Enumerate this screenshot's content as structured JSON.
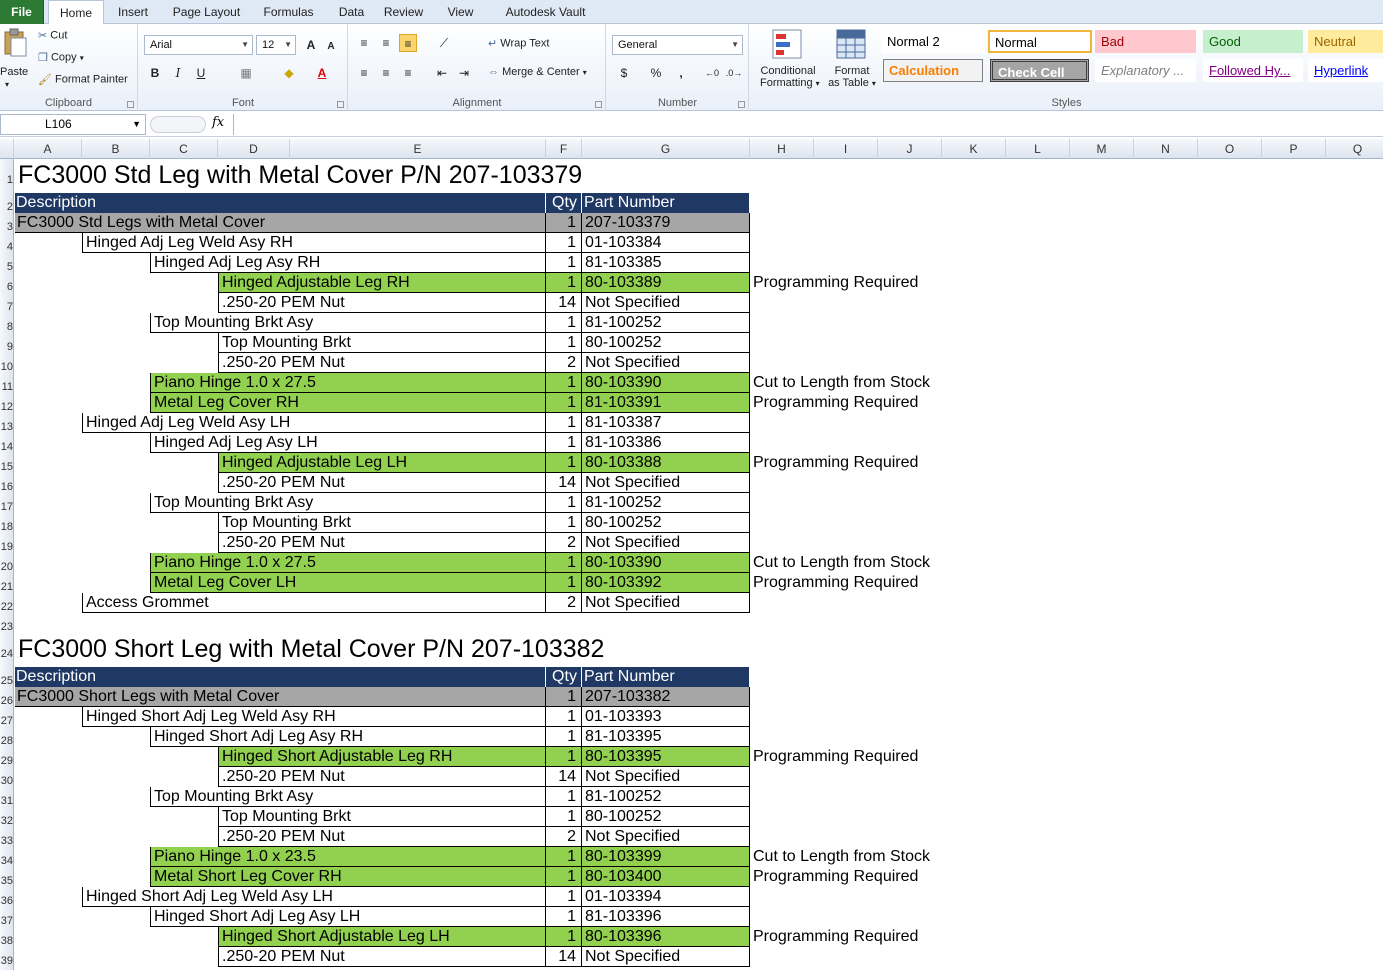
{
  "tabs": [
    {
      "label": "File",
      "kind": "file"
    },
    {
      "label": "Home",
      "kind": "active"
    },
    {
      "label": "Insert"
    },
    {
      "label": "Page Layout"
    },
    {
      "label": "Formulas"
    },
    {
      "label": "Data"
    },
    {
      "label": "Review"
    },
    {
      "label": "View"
    },
    {
      "label": "Autodesk Vault"
    }
  ],
  "ribbon": {
    "clipboard": {
      "paste": "Paste",
      "cut": "Cut",
      "copy": "Copy",
      "format_painter": "Format Painter",
      "group": "Clipboard"
    },
    "font": {
      "name": "Arial",
      "size": "12",
      "group": "Font",
      "bold": "B",
      "italic": "I",
      "underline": "U",
      "grow": "A",
      "shrink": "A"
    },
    "alignment": {
      "wrap": "Wrap Text",
      "merge": "Merge & Center",
      "group": "Alignment"
    },
    "number": {
      "format": "General",
      "currency": "$",
      "percent": "%",
      "comma": ",",
      "group": "Number"
    },
    "cond_format": {
      "line1": "Conditional",
      "line2": "Formatting"
    },
    "format_table": {
      "line1": "Format",
      "line2": "as Table"
    },
    "styles": {
      "group": "Styles",
      "items": [
        {
          "label": "Normal 2",
          "bg": "#ffffff",
          "fg": "#000000"
        },
        {
          "label": "Normal",
          "bg": "#ffffff",
          "fg": "#000000",
          "selected": true
        },
        {
          "label": "Bad",
          "bg": "#ffc7ce",
          "fg": "#9c0006"
        },
        {
          "label": "Good",
          "bg": "#c6efce",
          "fg": "#006100"
        },
        {
          "label": "Neutral",
          "bg": "#ffeb9c",
          "fg": "#9c6500"
        },
        {
          "label": "Calculation",
          "bg": "#f2f2f2",
          "fg": "#fa7d00"
        },
        {
          "label": "Check Cell",
          "bg": "#a5a5a5",
          "fg": "#ffffff"
        },
        {
          "label": "Explanatory ...",
          "bg": "#ffffff",
          "fg": "#7f7f7f"
        },
        {
          "label": "Followed Hy...",
          "bg": "#ffffff",
          "fg": "#800080"
        },
        {
          "label": "Hyperlink",
          "bg": "#ffffff",
          "fg": "#0000ff"
        }
      ]
    }
  },
  "formula_bar": {
    "name_box": "L106",
    "fx": "fx",
    "value": ""
  },
  "columns": [
    "A",
    "B",
    "C",
    "D",
    "E",
    "F",
    "G",
    "H",
    "I",
    "J",
    "K",
    "L",
    "M",
    "N",
    "O",
    "P",
    "Q"
  ],
  "rows": [
    "1",
    "2",
    "3",
    "4",
    "5",
    "6",
    "7",
    "8",
    "9",
    "10",
    "11",
    "12",
    "13",
    "14",
    "15",
    "16",
    "17",
    "18",
    "19",
    "20",
    "21",
    "22",
    "23",
    "24",
    "25",
    "26",
    "27",
    "28",
    "29",
    "30",
    "31",
    "32",
    "33",
    "34",
    "35",
    "36",
    "37",
    "38",
    "39"
  ],
  "sheet": {
    "section1": {
      "title": "FC3000 Std Leg with Metal Cover P/N 207-103379",
      "headers": {
        "desc": "Description",
        "qty": "Qty",
        "pn": "Part Number"
      },
      "items": [
        {
          "level": 0,
          "desc": "FC3000 Std Legs with Metal Cover",
          "qty": "1",
          "pn": "207-103379",
          "style": "gray",
          "note": ""
        },
        {
          "level": 1,
          "desc": "Hinged Adj Leg Weld Asy RH",
          "qty": "1",
          "pn": "01-103384",
          "style": "",
          "note": ""
        },
        {
          "level": 2,
          "desc": "Hinged Adj Leg Asy RH",
          "qty": "1",
          "pn": "81-103385",
          "style": "",
          "note": ""
        },
        {
          "level": 3,
          "desc": "Hinged Adjustable Leg RH",
          "qty": "1",
          "pn": "80-103389",
          "style": "green",
          "note": "Programming Required"
        },
        {
          "level": 3,
          "desc": ".250-20 PEM Nut",
          "qty": "14",
          "pn": "Not Specified",
          "style": "",
          "note": ""
        },
        {
          "level": 2,
          "desc": "Top Mounting Brkt Asy",
          "qty": "1",
          "pn": "81-100252",
          "style": "",
          "note": ""
        },
        {
          "level": 3,
          "desc": "Top Mounting Brkt",
          "qty": "1",
          "pn": "80-100252",
          "style": "",
          "note": ""
        },
        {
          "level": 3,
          "desc": ".250-20 PEM Nut",
          "qty": "2",
          "pn": "Not Specified",
          "style": "",
          "note": ""
        },
        {
          "level": 2,
          "desc": "Piano Hinge 1.0 x 27.5",
          "qty": "1",
          "pn": "80-103390",
          "style": "green",
          "note": "Cut to Length from Stock"
        },
        {
          "level": 2,
          "desc": "Metal Leg Cover RH",
          "qty": "1",
          "pn": "81-103391",
          "style": "green",
          "note": "Programming Required"
        },
        {
          "level": 1,
          "desc": "Hinged Adj Leg Weld Asy LH",
          "qty": "1",
          "pn": "81-103387",
          "style": "",
          "note": ""
        },
        {
          "level": 2,
          "desc": "Hinged Adj Leg Asy LH",
          "qty": "1",
          "pn": "81-103386",
          "style": "",
          "note": ""
        },
        {
          "level": 3,
          "desc": "Hinged Adjustable Leg LH",
          "qty": "1",
          "pn": "80-103388",
          "style": "green",
          "note": "Programming Required"
        },
        {
          "level": 3,
          "desc": ".250-20 PEM Nut",
          "qty": "14",
          "pn": "Not Specified",
          "style": "",
          "note": ""
        },
        {
          "level": 2,
          "desc": "Top Mounting Brkt Asy",
          "qty": "1",
          "pn": "81-100252",
          "style": "",
          "note": ""
        },
        {
          "level": 3,
          "desc": "Top Mounting Brkt",
          "qty": "1",
          "pn": "80-100252",
          "style": "",
          "note": ""
        },
        {
          "level": 3,
          "desc": ".250-20 PEM Nut",
          "qty": "2",
          "pn": "Not Specified",
          "style": "",
          "note": ""
        },
        {
          "level": 2,
          "desc": "Piano Hinge 1.0 x 27.5",
          "qty": "1",
          "pn": "80-103390",
          "style": "green",
          "note": "Cut to Length from Stock"
        },
        {
          "level": 2,
          "desc": "Metal Leg Cover LH",
          "qty": "1",
          "pn": "80-103392",
          "style": "green",
          "note": "Programming Required"
        },
        {
          "level": 1,
          "desc": "Access Grommet",
          "qty": "2",
          "pn": "Not Specified",
          "style": "",
          "note": ""
        }
      ]
    },
    "section2": {
      "title": "FC3000 Short Leg with Metal Cover P/N 207-103382",
      "headers": {
        "desc": "Description",
        "qty": "Qty",
        "pn": "Part Number"
      },
      "items": [
        {
          "level": 0,
          "desc": "FC3000 Short Legs with Metal Cover",
          "qty": "1",
          "pn": "207-103382",
          "style": "gray",
          "note": ""
        },
        {
          "level": 1,
          "desc": "Hinged Short Adj Leg Weld Asy RH",
          "qty": "1",
          "pn": "01-103393",
          "style": "",
          "note": ""
        },
        {
          "level": 2,
          "desc": "Hinged Short Adj Leg Asy RH",
          "qty": "1",
          "pn": "81-103395",
          "style": "",
          "note": ""
        },
        {
          "level": 3,
          "desc": "Hinged Short Adjustable Leg RH",
          "qty": "1",
          "pn": "80-103395",
          "style": "green",
          "note": "Programming Required"
        },
        {
          "level": 3,
          "desc": ".250-20 PEM Nut",
          "qty": "14",
          "pn": "Not Specified",
          "style": "",
          "note": ""
        },
        {
          "level": 2,
          "desc": "Top Mounting Brkt Asy",
          "qty": "1",
          "pn": "81-100252",
          "style": "",
          "note": ""
        },
        {
          "level": 3,
          "desc": "Top Mounting Brkt",
          "qty": "1",
          "pn": "80-100252",
          "style": "",
          "note": ""
        },
        {
          "level": 3,
          "desc": ".250-20 PEM Nut",
          "qty": "2",
          "pn": "Not Specified",
          "style": "",
          "note": ""
        },
        {
          "level": 2,
          "desc": "Piano Hinge 1.0 x 23.5",
          "qty": "1",
          "pn": "80-103399",
          "style": "green",
          "note": "Cut to Length from Stock"
        },
        {
          "level": 2,
          "desc": "Metal Short Leg Cover RH",
          "qty": "1",
          "pn": "80-103400",
          "style": "green",
          "note": "Programming Required"
        },
        {
          "level": 1,
          "desc": "Hinged Short Adj Leg Weld Asy LH",
          "qty": "1",
          "pn": "01-103394",
          "style": "",
          "note": ""
        },
        {
          "level": 2,
          "desc": "Hinged Short Adj Leg Asy LH",
          "qty": "1",
          "pn": "81-103396",
          "style": "",
          "note": ""
        },
        {
          "level": 3,
          "desc": "Hinged Short Adjustable Leg LH",
          "qty": "1",
          "pn": "80-103396",
          "style": "green",
          "note": "Programming Required"
        },
        {
          "level": 3,
          "desc": ".250-20 PEM Nut",
          "qty": "14",
          "pn": "Not Specified",
          "style": "",
          "note": ""
        }
      ]
    }
  }
}
